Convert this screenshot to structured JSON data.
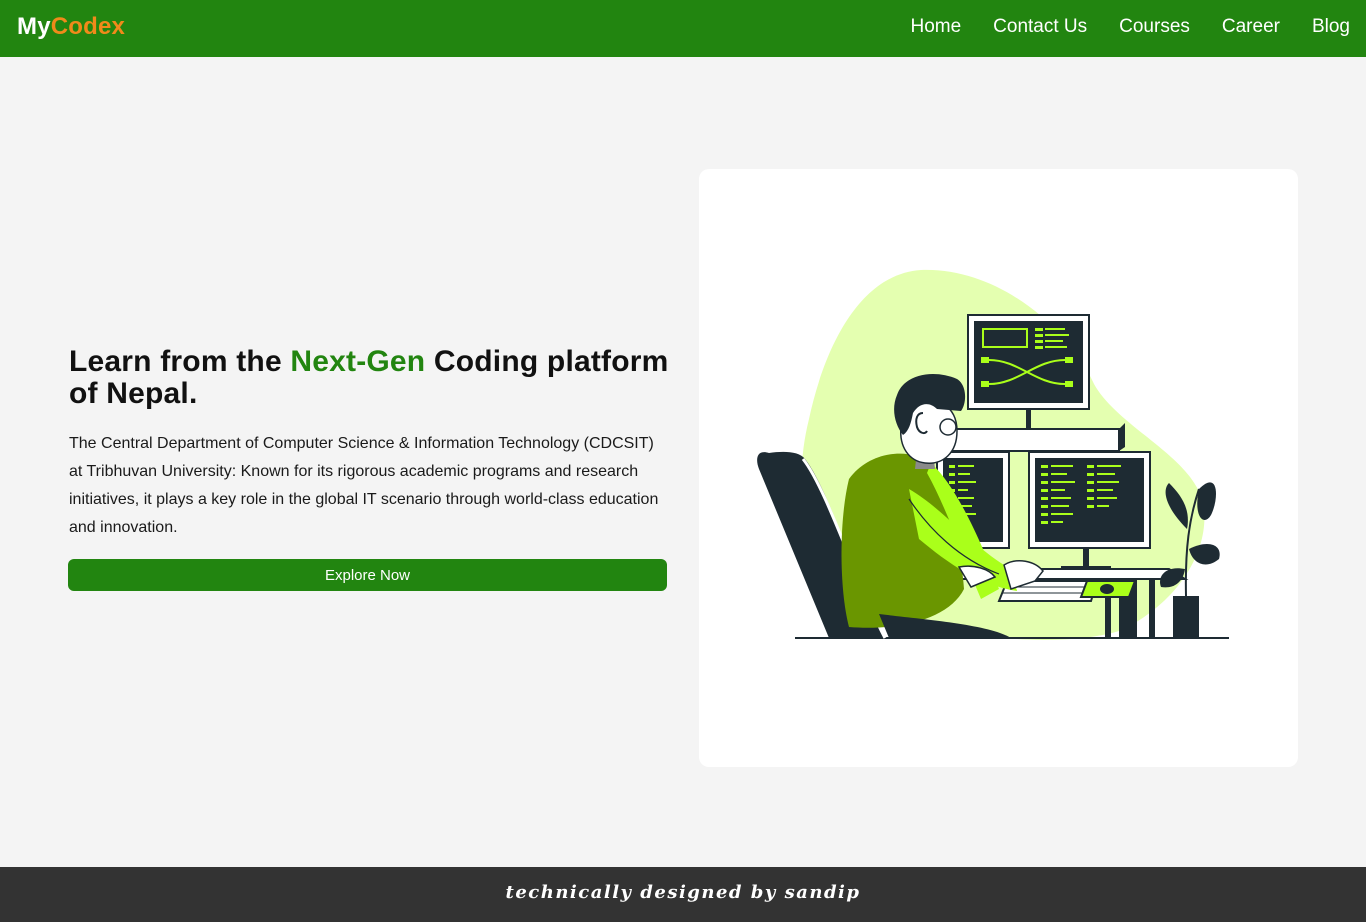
{
  "brand": {
    "part1": "My",
    "part2": "Codex"
  },
  "nav": {
    "items": [
      {
        "label": "Home"
      },
      {
        "label": "Contact Us"
      },
      {
        "label": "Courses"
      },
      {
        "label": "Career"
      },
      {
        "label": "Blog"
      }
    ]
  },
  "hero": {
    "title_prefix": "Learn from the ",
    "title_accent": "Next-Gen",
    "title_suffix": " Coding platform of Nepal.",
    "description": "The Central Department of Computer Science & Information Technology (CDCSIT) at Tribhuvan University: Known for its rigorous academic programs and research initiatives, it plays a key role in the global IT scenario through world-class education and innovation.",
    "cta_label": "Explore Now"
  },
  "footer": {
    "text": "technically designed by sandip"
  },
  "colors": {
    "brand_green": "#228510",
    "brand_orange": "#f08a1a",
    "page_bg": "#f4f4f4",
    "footer_bg": "#333333",
    "illustration_lime": "#aaff1a",
    "illustration_dark": "#1e2b33",
    "illustration_blob": "#e4ffb0"
  },
  "illustration": {
    "subject": "developer-at-workstation-illustration"
  }
}
